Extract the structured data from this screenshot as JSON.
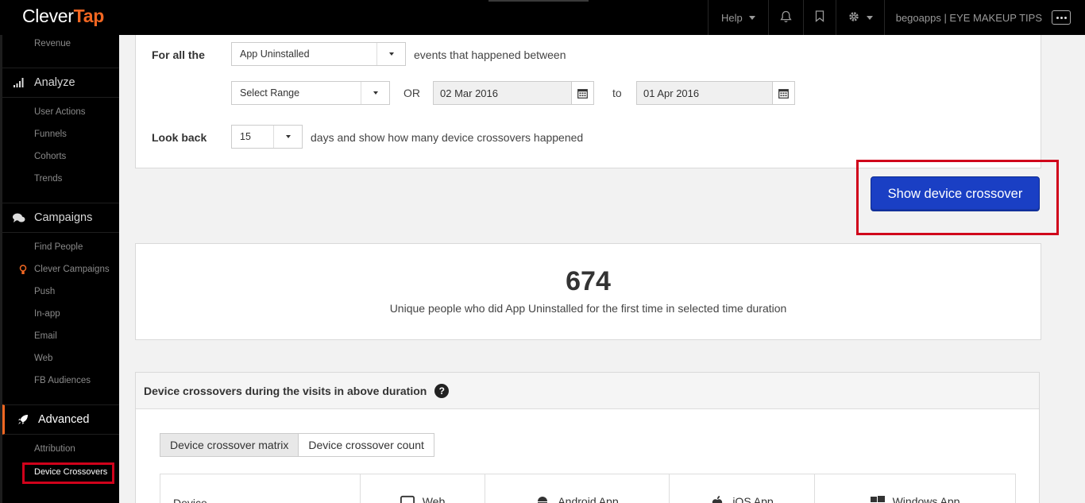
{
  "app": {
    "logo_a": "Clever",
    "logo_b": "Tap"
  },
  "topbar": {
    "help": "Help",
    "account": "begoapps | EYE MAKEUP TIPS"
  },
  "sidebar": {
    "revenue": "Revenue",
    "analyze": "Analyze",
    "analyze_items": [
      "User Actions",
      "Funnels",
      "Cohorts",
      "Trends"
    ],
    "campaigns": "Campaigns",
    "campaign_items": [
      "Find People",
      "Clever Campaigns",
      "Push",
      "In-app",
      "Email",
      "Web",
      "FB Audiences"
    ],
    "advanced": "Advanced",
    "advanced_items": [
      "Attribution",
      "Device Crossovers"
    ]
  },
  "filter": {
    "for_all_label": "For all the",
    "event_select": "App Uninstalled",
    "events_between": "events that happened between",
    "range_select": "Select Range",
    "or": "OR",
    "date_from": "02 Mar 2016",
    "to": "to",
    "date_to": "01 Apr 2016",
    "lookback_label": "Look back",
    "lookback_value": "15",
    "lookback_suffix": "days and show how many device crossovers happened"
  },
  "action": {
    "show_button": "Show device crossover"
  },
  "stat": {
    "value": "674",
    "description": "Unique people who did App Uninstalled for the first time in selected time duration"
  },
  "matrix": {
    "title": "Device crossovers during the visits in above duration",
    "tabs": [
      "Device crossover matrix",
      "Device crossover count"
    ],
    "columns": [
      "Device",
      "Web",
      "Android App",
      "iOS App",
      "Windows App"
    ]
  },
  "colors": {
    "accent": "#f26722",
    "primary": "#1a3fc4",
    "highlight": "#d0021b"
  }
}
